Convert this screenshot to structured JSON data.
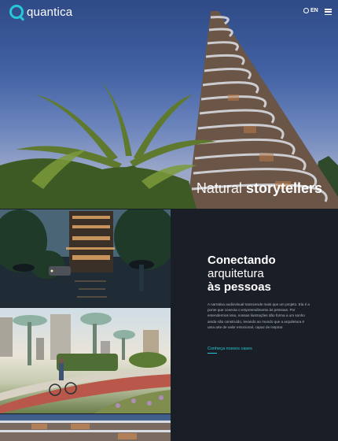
{
  "brand": {
    "name": "quantica",
    "accent": "#27c8d6"
  },
  "header": {
    "language": "EN"
  },
  "hero": {
    "title_light": "Natural",
    "title_bold": "storytellers"
  },
  "section": {
    "heading_line1": "Conectando",
    "heading_line2": "arquitetura",
    "heading_line3": "às pessoas",
    "body": "A narrativa audiovisual transcende mais que um projeto. Ela é a ponte que conecta o empreendimento às pessoas. Por entendermos isso, nossas ilustrações dão forma a um sonho ainda não construído, levando ao mundo que a arquitetura é uma arte de valor emocional, capaz de inspirar.",
    "cta": "Conheça nossos cases"
  },
  "colors": {
    "background": "#1a1f27",
    "text": "#ffffff",
    "muted": "#b3b8c0"
  }
}
